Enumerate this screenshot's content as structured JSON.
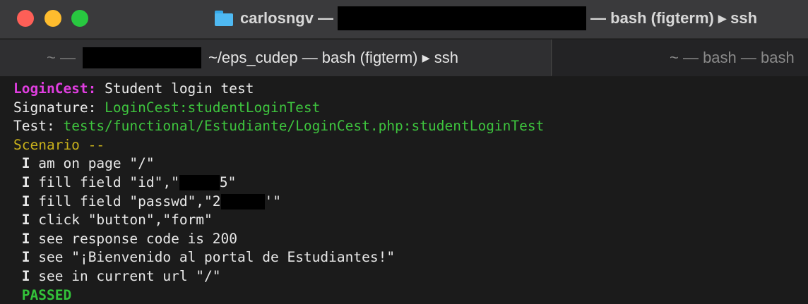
{
  "window": {
    "title_user": "carlosngv —",
    "title_suffix": "— bash (figterm) ▸ ssh"
  },
  "tabs": [
    {
      "prefix": "~ —",
      "label": "~/eps_cudep — bash (figterm) ▸ ssh"
    },
    {
      "label": "~ — bash — bash"
    }
  ],
  "terminal": {
    "cest_name": "LoginCest:",
    "cest_title": "Student login test",
    "signature_label": "Signature:",
    "signature_value": "LoginCest:studentLoginTest",
    "test_label": "Test:",
    "test_value": "tests/functional/Estudiante/LoginCest.php:studentLoginTest",
    "scenario": "Scenario --",
    "steps": [
      {
        "i": "I",
        "text": "am on page \"/\""
      },
      {
        "i": "I",
        "text_before": "fill field \"id\",\"",
        "text_after": "5\""
      },
      {
        "i": "I",
        "text_before": "fill field \"passwd\",\"2",
        "text_after": "'\""
      },
      {
        "i": "I",
        "text": "click \"button\",\"form\""
      },
      {
        "i": "I",
        "text": "see response code is 200"
      },
      {
        "i": "I",
        "text": "see \"¡Bienvenido al portal de Estudiantes!\""
      },
      {
        "i": "I",
        "text": "see in current url \"/\""
      }
    ],
    "result": "PASSED"
  },
  "colors": {
    "magenta": "#e03ee0",
    "green": "#3ec43e",
    "yellow": "#c9b11b",
    "close": "#fe5f57",
    "minimize": "#febc2e",
    "maximize": "#28c840"
  }
}
